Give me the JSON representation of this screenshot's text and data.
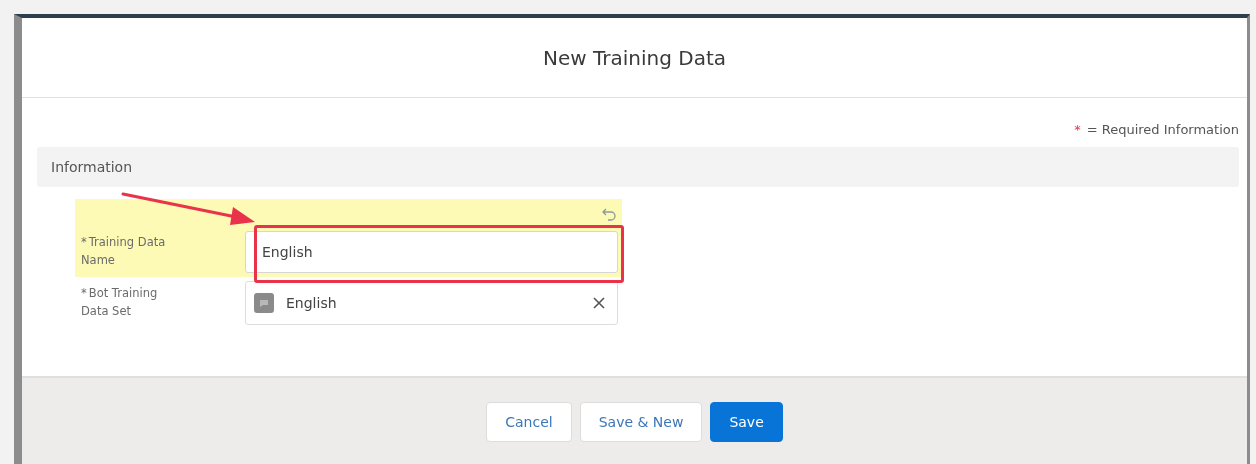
{
  "modal": {
    "title": "New Training Data"
  },
  "legend": {
    "mark": "*",
    "text": "= Required Information"
  },
  "section": {
    "title": "Information"
  },
  "fields": [
    {
      "kind": "text",
      "mark": "*",
      "label": "Training Data Name",
      "value": "English",
      "highlighted": true,
      "changed": true
    },
    {
      "kind": "lookup",
      "mark": "*",
      "label": "Bot Training Data Set",
      "value": "English",
      "highlighted": false,
      "changed": false
    }
  ],
  "buttons": [
    {
      "label": "Cancel",
      "kind": "neutral"
    },
    {
      "label": "Save & New",
      "kind": "neutral"
    },
    {
      "label": "Save",
      "kind": "brand"
    }
  ]
}
